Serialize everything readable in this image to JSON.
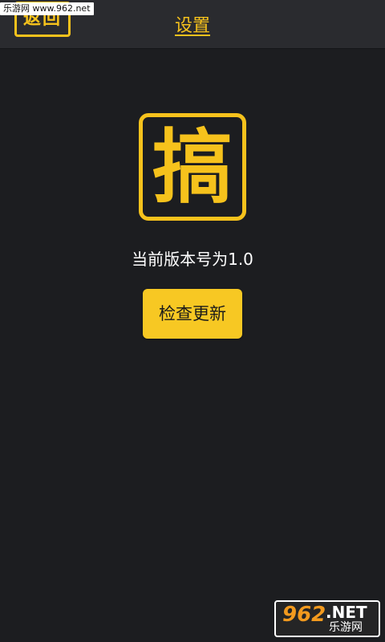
{
  "watermark": {
    "top_text": "乐游网 www.962.net",
    "bottom_number": "962",
    "bottom_net": ".NET",
    "bottom_cn": "乐游网"
  },
  "header": {
    "back_label": "返回",
    "title": "设置"
  },
  "logo": {
    "glyph": "搞"
  },
  "main": {
    "version_text": "当前版本号为1.0",
    "check_update_label": "检查更新"
  },
  "colors": {
    "accent": "#f6c21c",
    "background": "#1c1d20",
    "header_background": "#2a2b2f"
  },
  "icons": {
    "logo": "app-logo-icon"
  }
}
